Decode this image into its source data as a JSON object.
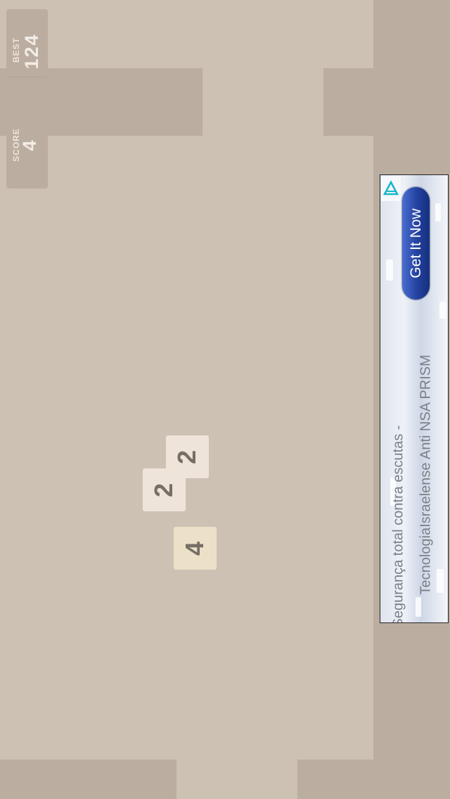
{
  "scores": {
    "best_label": "BEST",
    "best_value": "124",
    "score_label": "SCORE",
    "score_value": "4"
  },
  "board": {
    "tiles": [
      {
        "value": "2"
      },
      {
        "value": "2"
      },
      {
        "value": "4"
      }
    ]
  },
  "ad": {
    "button_label": "Get It Now",
    "line1": "Segurança total contra escutas -",
    "line2": "TecnologiaIsraelense Anti NSA PRISM",
    "logo_icon": "triangle-logo-icon"
  },
  "colors": {
    "background": "#cdc1b4",
    "panel": "#bbada0",
    "tile_2": "#eee4da",
    "tile_4": "#ede0c8",
    "tile_text": "#776e65",
    "ad_button": "#23419f"
  }
}
